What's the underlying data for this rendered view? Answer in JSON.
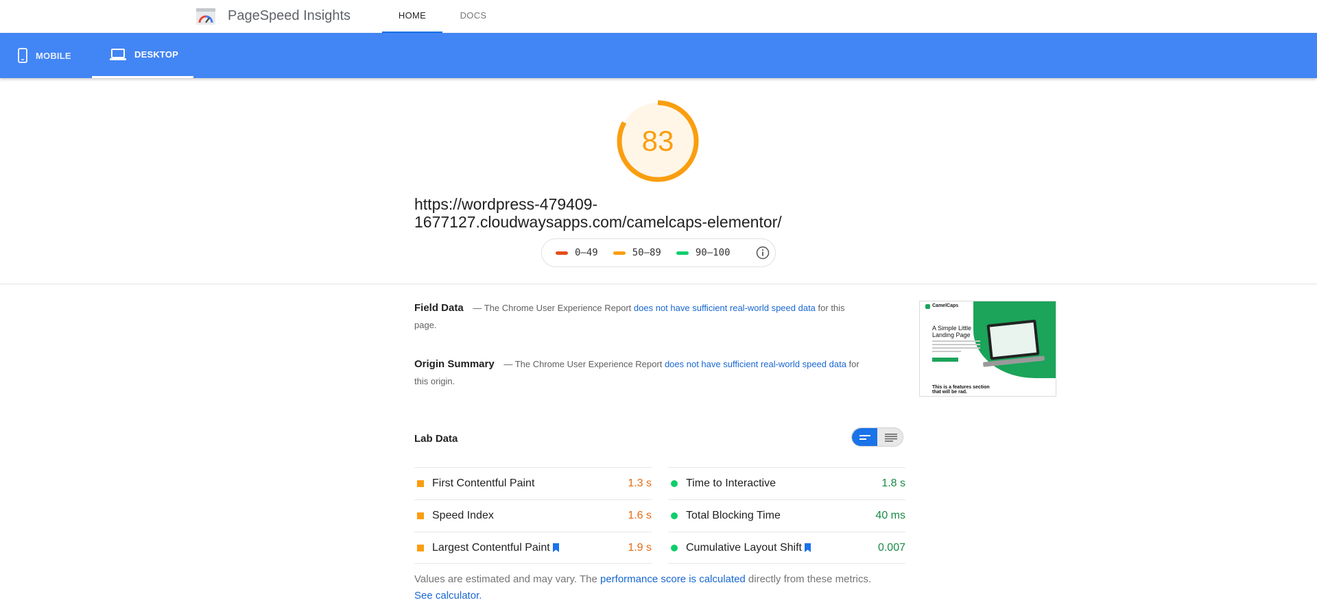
{
  "header": {
    "app_title": "PageSpeed Insights",
    "logo_icon": "pagespeed-logo-icon",
    "nav": [
      {
        "label": "HOME",
        "active": true
      },
      {
        "label": "DOCS",
        "active": false
      }
    ]
  },
  "devices": {
    "tabs": [
      {
        "label": "MOBILE",
        "icon": "phone-icon",
        "active": false
      },
      {
        "label": "DESKTOP",
        "icon": "laptop-icon",
        "active": true
      }
    ],
    "bar_color": "#4285f4"
  },
  "score": {
    "value": "83",
    "fraction": 0.83,
    "color": "#fa9e0f"
  },
  "url": "https://wordpress-479409-1677127.cloudwaysapps.com/camelcaps-elementor/",
  "legend": {
    "items": [
      {
        "range": "0–49",
        "color": "#e34f1b"
      },
      {
        "range": "50–89",
        "color": "#fa9e0f"
      },
      {
        "range": "90–100",
        "color": "#0cce6b"
      }
    ],
    "info_icon": "info-icon"
  },
  "field_data": {
    "heading": "Field Data",
    "dash": "—",
    "text_before": "The Chrome User Experience Report",
    "link": "does not have sufficient real-world speed data",
    "text_after": "for this page."
  },
  "origin_summary": {
    "heading": "Origin Summary",
    "dash": "—",
    "text_before": "The Chrome User Experience Report",
    "link": "does not have sufficient real-world speed data",
    "text_after": "for this origin."
  },
  "thumbnail": {
    "brand": "CamelCaps",
    "title_line1": "A Simple Little",
    "title_line2": "Landing Page",
    "footer_line1": "This is a features section",
    "footer_line2": "that will be rad."
  },
  "lab_data": {
    "heading": "Lab Data",
    "view_toggle": {
      "active": "collapsed",
      "icons": [
        "list-collapsed-icon",
        "list-expanded-icon"
      ]
    },
    "metrics_left": [
      {
        "label": "First Contentful Paint",
        "value": "1.3 s",
        "status": "average",
        "bookmark": false
      },
      {
        "label": "Speed Index",
        "value": "1.6 s",
        "status": "average",
        "bookmark": false
      },
      {
        "label": "Largest Contentful Paint",
        "value": "1.9 s",
        "status": "average",
        "bookmark": true
      }
    ],
    "metrics_right": [
      {
        "label": "Time to Interactive",
        "value": "1.8 s",
        "status": "pass",
        "bookmark": false
      },
      {
        "label": "Total Blocking Time",
        "value": "40 ms",
        "status": "pass",
        "bookmark": false
      },
      {
        "label": "Cumulative Layout Shift",
        "value": "0.007",
        "status": "pass",
        "bookmark": true
      }
    ]
  },
  "footnote": {
    "text_before": "Values are estimated and may vary. The",
    "link1": "performance score is calculated",
    "text_middle": "directly from these metrics.",
    "link2": "See calculator."
  }
}
